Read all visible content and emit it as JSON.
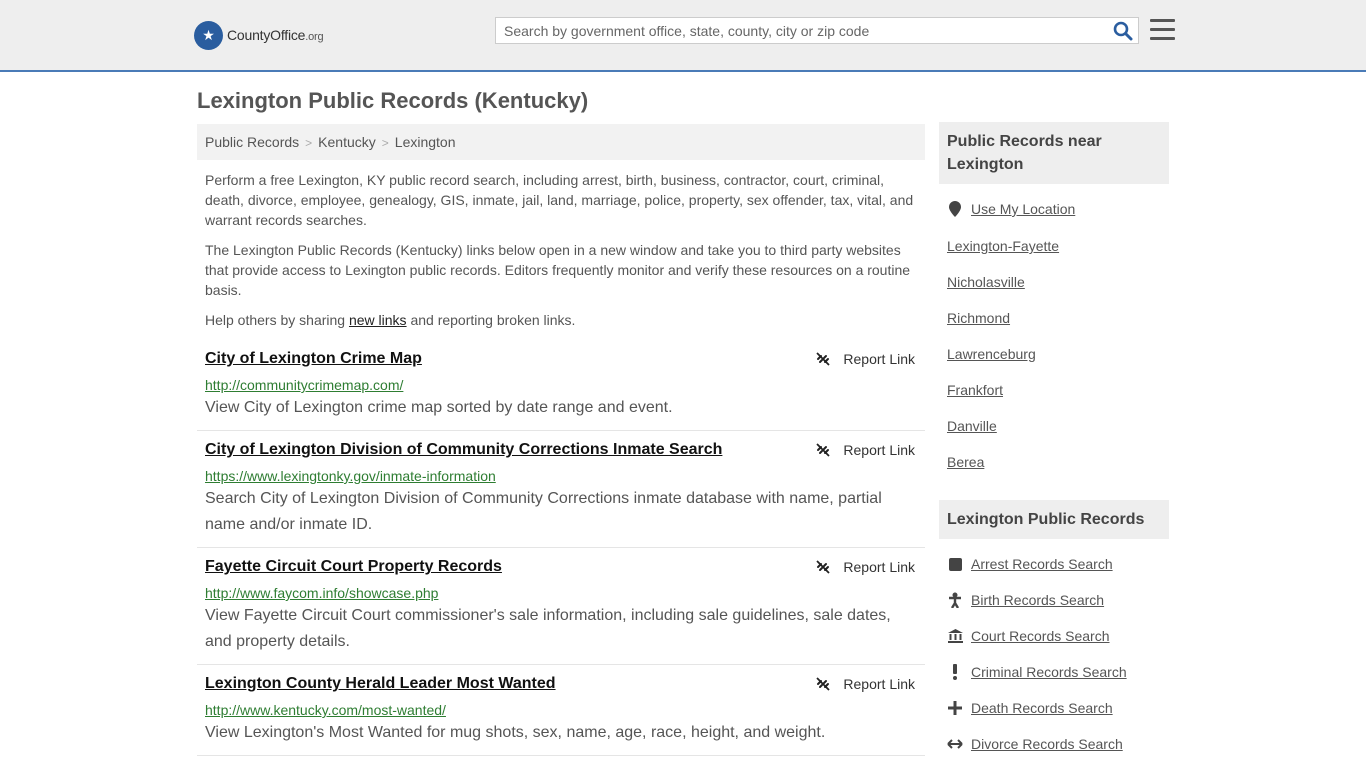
{
  "header": {
    "logo_main": "CountyOffice",
    "logo_suffix": ".org",
    "search_placeholder": "Search by government office, state, county, city or zip code"
  },
  "page": {
    "title": "Lexington Public Records (Kentucky)"
  },
  "breadcrumb": [
    "Public Records",
    "Kentucky",
    "Lexington"
  ],
  "intro": {
    "p1": "Perform a free Lexington, KY public record search, including arrest, birth, business, contractor, court, criminal, death, divorce, employee, genealogy, GIS, inmate, jail, land, marriage, police, property, sex offender, tax, vital, and warrant records searches.",
    "p2": "The Lexington Public Records (Kentucky) links below open in a new window and take you to third party websites that provide access to Lexington public records. Editors frequently monitor and verify these resources on a routine basis.",
    "p3_before": "Help others by sharing ",
    "p3_link": "new links",
    "p3_after": " and reporting broken links."
  },
  "report_label": "Report Link",
  "records": [
    {
      "title": "City of Lexington Crime Map",
      "url": "http://communitycrimemap.com/",
      "desc": "View City of Lexington crime map sorted by date range and event."
    },
    {
      "title": "City of Lexington Division of Community Corrections Inmate Search",
      "url": "https://www.lexingtonky.gov/inmate-information",
      "desc": "Search City of Lexington Division of Community Corrections inmate database with name, partial name and/or inmate ID."
    },
    {
      "title": "Fayette Circuit Court Property Records",
      "url": "http://www.faycom.info/showcase.php",
      "desc": "View Fayette Circuit Court commissioner's sale information, including sale guidelines, sale dates, and property details."
    },
    {
      "title": "Lexington County Herald Leader Most Wanted",
      "url": "http://www.kentucky.com/most-wanted/",
      "desc": "View Lexington's Most Wanted for mug shots, sex, name, age, race, height, and weight."
    }
  ],
  "sidebar": {
    "nearby_title": "Public Records near Lexington",
    "use_location": "Use My Location",
    "nearby": [
      "Lexington-Fayette",
      "Nicholasville",
      "Richmond",
      "Lawrenceburg",
      "Frankfort",
      "Danville",
      "Berea"
    ],
    "records_title": "Lexington Public Records",
    "records": [
      {
        "label": "Arrest Records Search",
        "icon": "square-icon"
      },
      {
        "label": "Birth Records Search",
        "icon": "person-icon"
      },
      {
        "label": "Court Records Search",
        "icon": "courthouse-icon"
      },
      {
        "label": "Criminal Records Search",
        "icon": "exclamation-icon"
      },
      {
        "label": "Death Records Search",
        "icon": "cross-icon"
      },
      {
        "label": "Divorce Records Search",
        "icon": "arrows-icon"
      }
    ]
  },
  "colors": {
    "accent": "#2a5d9f",
    "url_green": "#2e7d32",
    "header_bg": "#eeeeee"
  }
}
